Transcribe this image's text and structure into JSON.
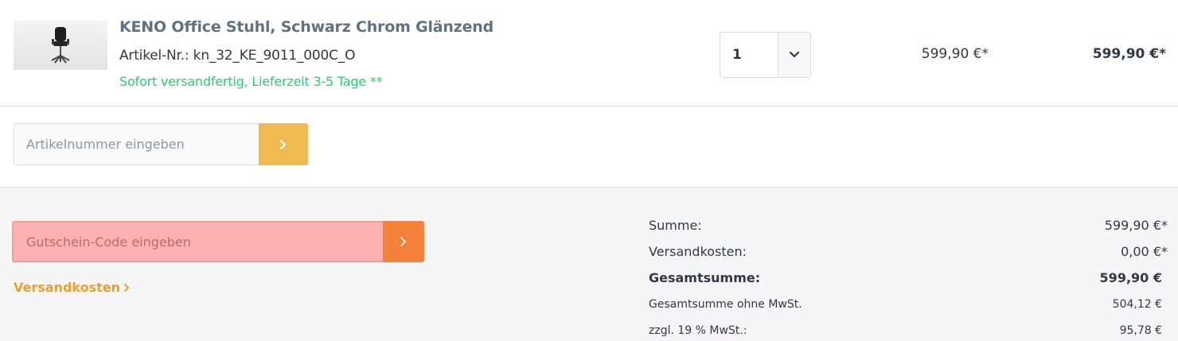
{
  "product": {
    "name": "KENO Office Stuhl, Schwarz Chrom Glänzend",
    "sku_label": "Artikel-Nr.:",
    "sku_value": "kn_32_KE_9011_000C_O",
    "delivery": "Sofort versandfertig, Lieferzeit 3-5 Tage **",
    "quantity": "1",
    "unit_price": "599,90 €*",
    "total_price": "599,90 €*",
    "image_icon": "office-chair"
  },
  "add_article": {
    "placeholder": "Artikelnummer eingeben",
    "submit_icon": "chevron-right"
  },
  "voucher": {
    "placeholder": "Gutschein-Code eingeben",
    "submit_icon": "chevron-right"
  },
  "shipping_link": {
    "label": "Versandkosten"
  },
  "summary": {
    "rows": [
      {
        "label": "Summe:",
        "value": "599,90 €*"
      },
      {
        "label": "Versandkosten:",
        "value": "0,00 €*"
      },
      {
        "label": "Gesamtsumme:",
        "value": "599,90 €"
      },
      {
        "label": "Gesamtsumme ohne MwSt.",
        "value": "504,12 €"
      },
      {
        "label": "zzgl. 19 % MwSt.:",
        "value": "95,78 €"
      }
    ]
  },
  "colors": {
    "product_name": "#5f7285",
    "delivery": "#2ecc71",
    "article_button": "#f0ba53",
    "voucher_button": "#f5823a",
    "voucher_highlight": "#ffb0b0",
    "shipping_link": "#e9a12e",
    "footer_bg": "#f5f5f8"
  }
}
